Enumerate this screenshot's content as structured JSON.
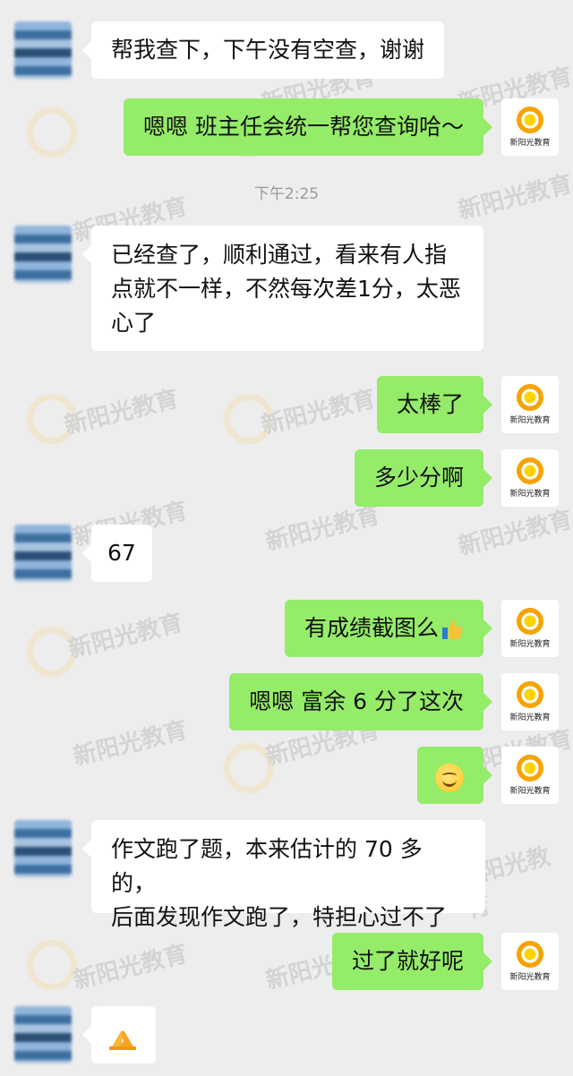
{
  "watermark": {
    "brand": "新阳光教育"
  },
  "timestamp": "下午2:25",
  "messages": [
    {
      "side": "left",
      "text": "帮我查下，下午没有空查，谢谢"
    },
    {
      "side": "right",
      "text": "嗯嗯 班主任会统一帮您查询哈～"
    },
    {
      "side": "left",
      "line1": "已经查了，顺利通过，看来有人指",
      "line2": "点就不一样，不然每次差1分，太恶",
      "line3": "心了"
    },
    {
      "side": "right",
      "text": "太棒了"
    },
    {
      "side": "right",
      "text": "多少分啊"
    },
    {
      "side": "left",
      "text": "67"
    },
    {
      "side": "right",
      "text": "有成绩截图么",
      "emoji": "thumbs-up"
    },
    {
      "side": "right",
      "text": "嗯嗯 富余 6 分了这次"
    },
    {
      "side": "right",
      "emoji": "smiling-face"
    },
    {
      "side": "left",
      "line1": "作文跑了题，本来估计的 70 多的，",
      "line2": "后面发现作文跑了，特担心过不了"
    },
    {
      "side": "right",
      "text": "过了就好呢"
    },
    {
      "side": "left",
      "emoji": "folded-hands"
    }
  ],
  "agent_avatar": {
    "brand": "新阳光教育"
  },
  "colors": {
    "background": "#ededed",
    "sent_bubble": "#95ec69",
    "received_bubble": "#ffffff",
    "timestamp": "#9a9a9a"
  }
}
